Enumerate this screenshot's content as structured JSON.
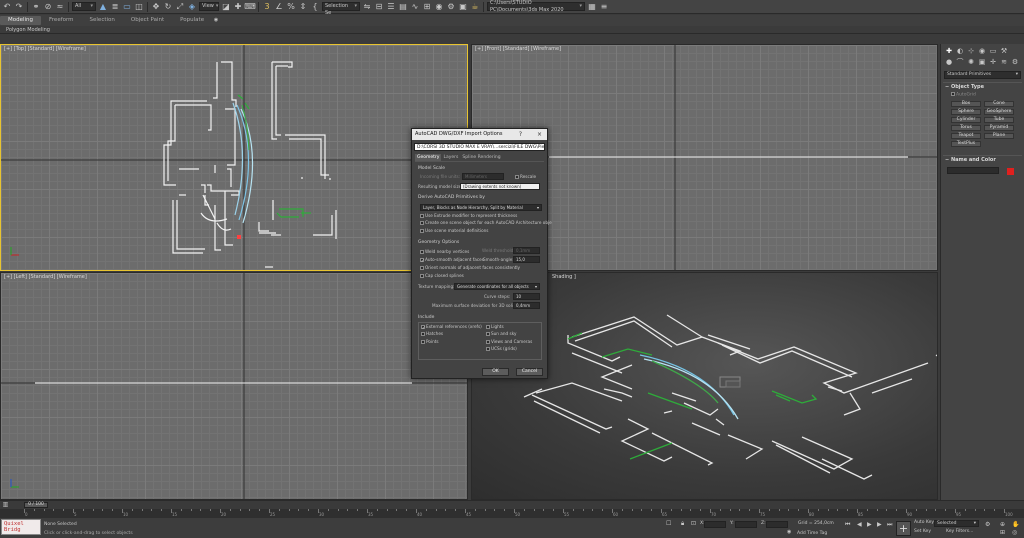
{
  "toolbar": {
    "undo_icon": "undo-icon",
    "redo_icon": "redo-icon",
    "filter_value": "All",
    "view_value": "View",
    "selection_set_placeholder": "Create Selection Se",
    "project_path": "C:\\Users\\STUDIO PC\\Documents\\3ds Max 2020"
  },
  "ribbon": {
    "tabs": [
      "Modeling",
      "Freeform",
      "Selection",
      "Object Paint",
      "Populate"
    ],
    "subtitle": "Polygon Modeling"
  },
  "viewports": {
    "top_label": "[+] [Top] [Standard] [Wireframe]",
    "front_label": "[+] [Front] [Standard] [Wireframe]",
    "left_label": "[+] [Left] [Standard] [Wireframe]",
    "persp_label": "Shading ]"
  },
  "command_panel": {
    "tab_icons": [
      "create-icon",
      "modify-icon",
      "hierarchy-icon",
      "motion-icon",
      "display-icon",
      "utilities-icon"
    ],
    "category": "Standard Primitives",
    "object_type_header": "Object Type",
    "autogrid": "AutoGrid",
    "buttons": [
      "Box",
      "Cone",
      "Sphere",
      "GeoSphere",
      "Cylinder",
      "Tube",
      "Torus",
      "Pyramid",
      "Teapot",
      "Plane",
      "TextPlus"
    ],
    "name_color_header": "Name and Color",
    "object_color": "#e0201e"
  },
  "dialog": {
    "title": "AutoCAD DWG/DXF Import Options",
    "help": "?",
    "close": "×",
    "path": "D:\\CORSI 3D STUDIO MAX E VRAY\\...sercizi\\FILE DWG\\Pieris 3D.dwg",
    "tabs": [
      "Geometry",
      "Layers",
      "Spline Rendering"
    ],
    "active_tab": "Geometry",
    "model_scale_header": "Model Scale",
    "incoming_units_label": "Incoming file units:",
    "incoming_units_value": "Millimeters",
    "rescale_label": "Rescale",
    "resulting_size_label": "Resulting model size:",
    "resulting_size_value": "(Drawing extents not known)",
    "derive_header": "Derive AutoCAD Primitives by",
    "derive_value": "Layer, Blocks as Node Hierarchy, Split by Material",
    "derive_options": [
      {
        "label": "Use Extrude modifier to represent thickness",
        "checked": false
      },
      {
        "label": "Create one scene object for each AutoCAD Architecture obje",
        "checked": false
      },
      {
        "label": "Use scene material definitions",
        "checked": false
      }
    ],
    "geometry_header": "Geometry Options",
    "weld_label": "Weld nearby vertices",
    "weld_threshold_label": "Weld threshold:",
    "weld_threshold_value": "0,1mm",
    "auto_smooth_label": "Auto-smooth adjacent faces",
    "smooth_angle_label": "Smooth-angle:",
    "smooth_angle_value": "15,0",
    "orient_normals_label": "Orient normals of adjacent faces consistently",
    "cap_splines_label": "Cap closed splines",
    "texture_label": "Texture mapping:",
    "texture_value": "Generate coordinates for all objects",
    "curve_steps_label": "Curve steps:",
    "curve_steps_value": "10",
    "max_dev_label": "Maximum surface deviation for 3D solids:",
    "max_dev_value": "0,4mm",
    "include_header": "Include",
    "include_left": [
      {
        "label": "External references (xrefs)",
        "checked": true
      },
      {
        "label": "Hatches",
        "checked": false
      },
      {
        "label": "Points",
        "checked": false
      }
    ],
    "include_right": [
      {
        "label": "Lights",
        "checked": false
      },
      {
        "label": "Sun and sky",
        "checked": false
      },
      {
        "label": "Views and Cameras",
        "checked": false
      },
      {
        "label": "UCSs (grids)",
        "checked": false
      }
    ],
    "ok_label": "OK",
    "cancel_label": "Cancel"
  },
  "timeline": {
    "frame_display": "0 / 100",
    "ticks": [
      0,
      5,
      10,
      15,
      20,
      25,
      30,
      35,
      40,
      45,
      50,
      55,
      60,
      65,
      70,
      75,
      80,
      85,
      90,
      95,
      100
    ]
  },
  "status": {
    "maxscript": "Quixel Bridg",
    "selection": "None Selected",
    "prompt": "Click or click-and-drag to select objects",
    "x_label": "X:",
    "x_value": "",
    "y_label": "Y:",
    "y_value": "",
    "z_label": "Z:",
    "z_value": "",
    "grid": "Grid = 254,0cm",
    "add_time_tag": "Add Time Tag",
    "auto_key": "Auto Key",
    "set_key": "Set Key",
    "selected": "Selected",
    "key_filters": "Key Filters..."
  }
}
